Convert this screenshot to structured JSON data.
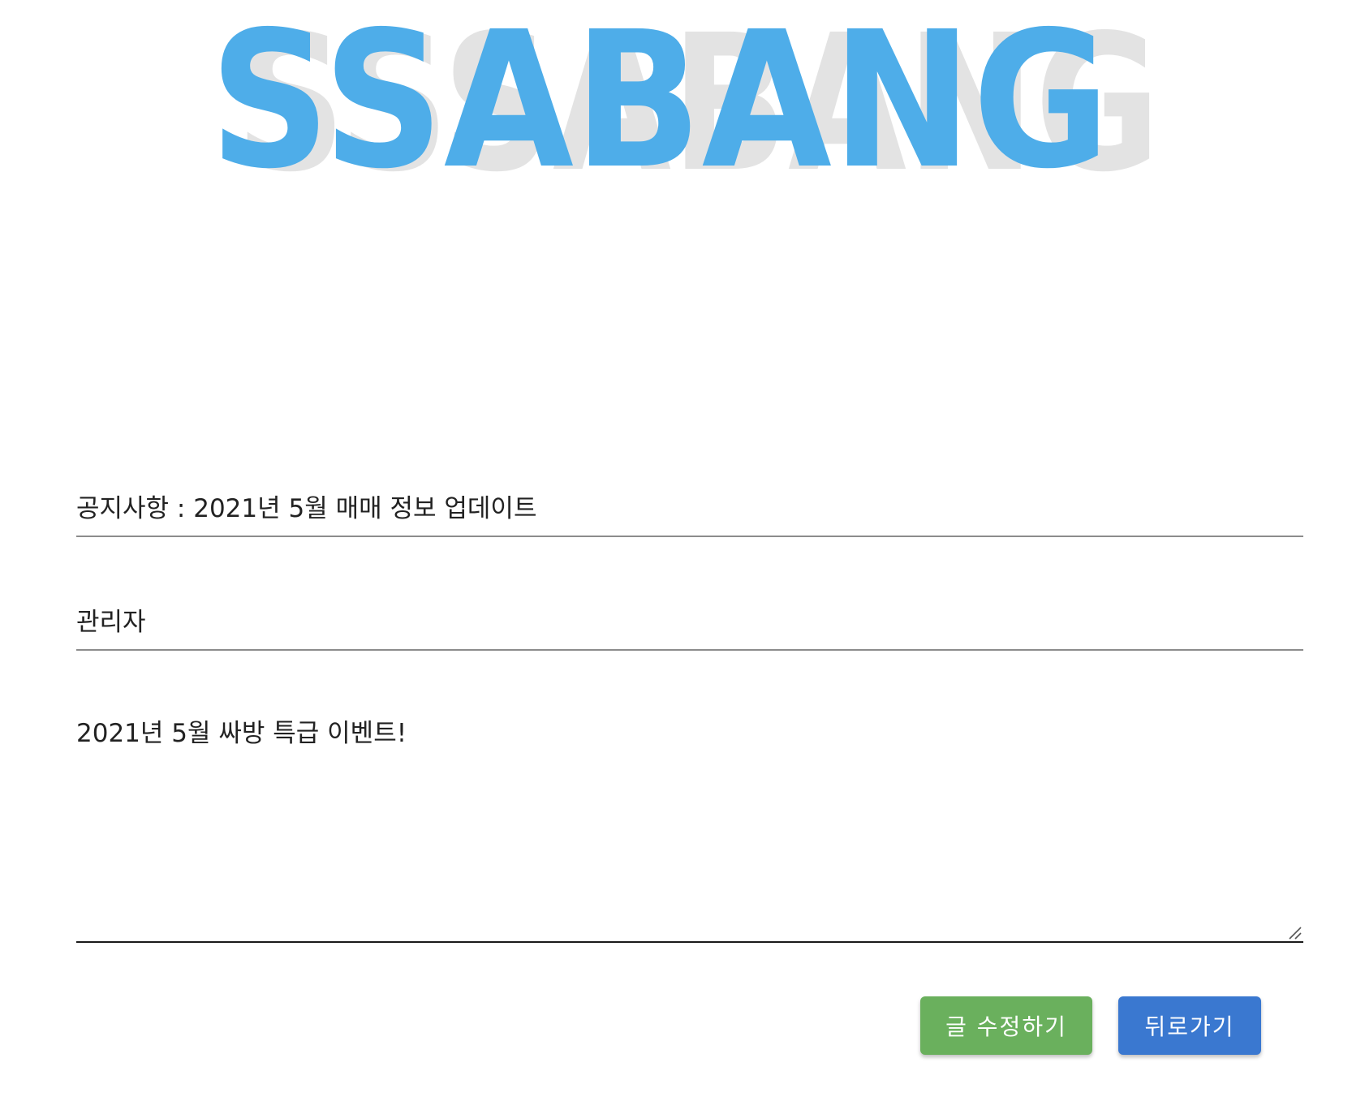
{
  "logo": {
    "text": "SSABANG",
    "shadow_text": "SSSABANG",
    "color": "#4eade9",
    "shadow_color": "#e3e3e3"
  },
  "form": {
    "title_value": "공지사항 : 2021년 5월 매매 정보 업데이트",
    "author_value": "관리자",
    "content_value": "2021년 5월 싸방 특급 이벤트!"
  },
  "buttons": {
    "edit_label": "글 수정하기",
    "edit_color": "#6ab05d",
    "back_label": "뒤로가기",
    "back_color": "#3a78d0"
  }
}
